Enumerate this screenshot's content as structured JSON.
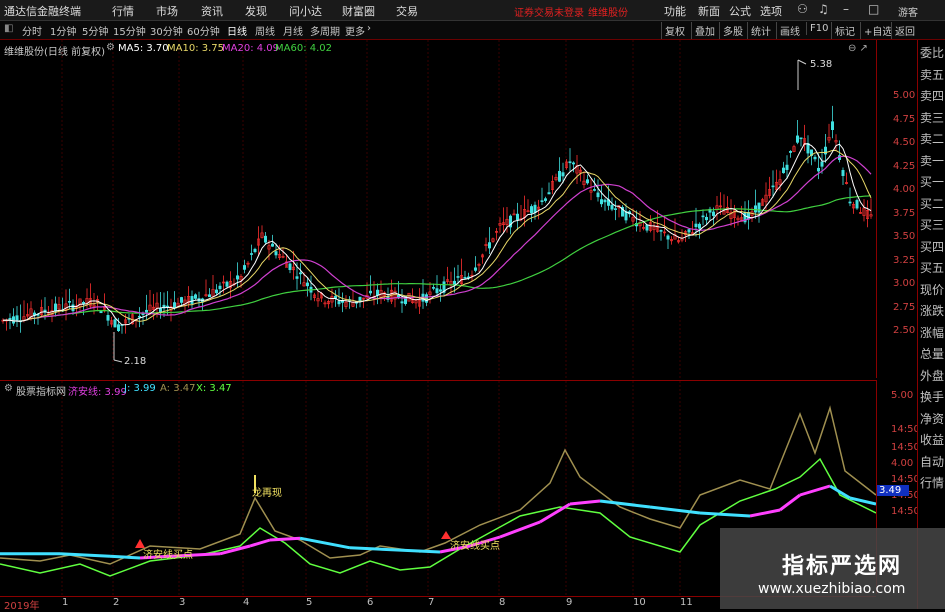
{
  "titlebar": {
    "app_name": "通达信金融终端",
    "menu": [
      "行情",
      "市场",
      "资讯",
      "发现",
      "问小达",
      "财富圈",
      "交易"
    ],
    "warning": "证券交易未登录",
    "stock_link": "维维股份",
    "right_menu": [
      "功能",
      "新面",
      "公式",
      "选项"
    ],
    "user": "游客"
  },
  "toolbar": {
    "periods": [
      "分时",
      "1分钟",
      "5分钟",
      "15分钟",
      "30分钟",
      "60分钟",
      "日线",
      "周线",
      "月线",
      "多周期",
      "更多"
    ],
    "active": "日线",
    "right": [
      "复权",
      "叠加",
      "多股",
      "统计",
      "画线",
      "F10",
      "标记",
      "+自选",
      "返回"
    ]
  },
  "main_legend": {
    "stock": "维维股份(日线 前复权)",
    "ma5": "MA5: 3.70",
    "ma10": "MA10: 3.75",
    "ma20": "MA20: 4.09",
    "ma60": "MA60: 4.02"
  },
  "price_axis": [
    "5.00",
    "4.75",
    "4.50",
    "4.25",
    "4.00",
    "3.75",
    "3.50",
    "3.25",
    "3.00",
    "2.75",
    "2.50"
  ],
  "high_label": "5.38",
  "low_label": "2.18",
  "ind_legend": {
    "name": "股票指标网",
    "line1": "济安线: 3.99",
    "j": "J: 3.99",
    "a": "A: 3.47",
    "x": "X: 3.47"
  },
  "ind_axis": [
    "5.00",
    "14:50",
    "14:50",
    "4.00",
    "14:50",
    "14:50",
    "14:50"
  ],
  "ind_value_tag": "3.49",
  "annotations": {
    "buy1": "济安线买点",
    "buy2": "济安线买点",
    "again": "龙再现"
  },
  "right_panel": [
    "委比",
    "卖五",
    "卖四",
    "卖三",
    "卖二",
    "卖一",
    "买一",
    "买二",
    "买三",
    "买四",
    "买五",
    "现价",
    "涨跌",
    "涨幅",
    "总量",
    "外盘",
    "换手",
    "净资",
    "收益",
    "自动",
    "行情"
  ],
  "dates": [
    "2019年",
    "1",
    "2",
    "3",
    "4",
    "5",
    "6",
    "7",
    "8",
    "9",
    "10",
    "11"
  ],
  "watermark": {
    "title": "指标严选网",
    "url": "www.xuezhibiao.com"
  },
  "colors": {
    "up": "#ff3030",
    "down": "#40e0e0",
    "ma5": "#ffffff",
    "ma10": "#f0e060",
    "ma20": "#e040e0",
    "ma60": "#40d040",
    "cyan": "#40e0ff",
    "magenta": "#ff40ff",
    "green": "#60ff40",
    "khaki": "#a09050"
  }
}
